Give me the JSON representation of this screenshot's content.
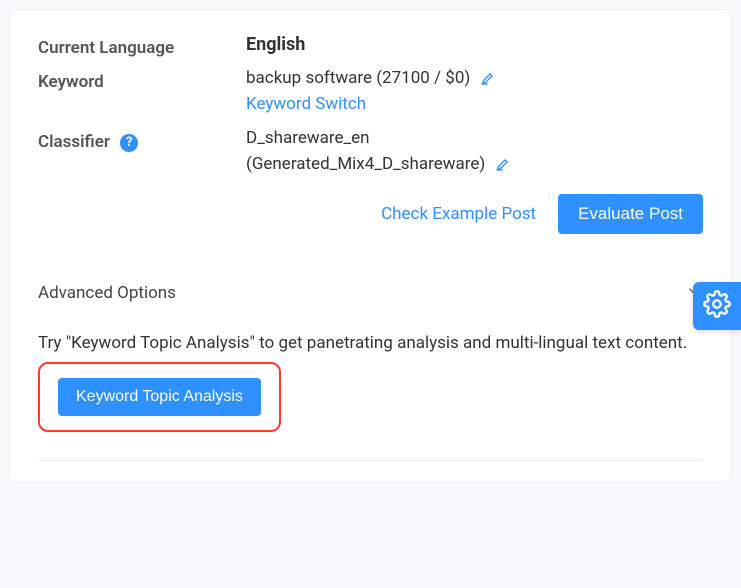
{
  "form": {
    "language_label": "Current Language",
    "language_value": "English",
    "keyword_label": "Keyword",
    "keyword_value": "backup software (27100 / $0)",
    "keyword_switch": "Keyword Switch",
    "classifier_label": "Classifier",
    "classifier_value": "D_shareware_en",
    "classifier_sub": "(Generated_Mix4_D_shareware)"
  },
  "actions": {
    "check_example": "Check Example Post",
    "evaluate": "Evaluate Post"
  },
  "advanced": {
    "title": "Advanced Options",
    "hint": "Try \"Keyword Topic Analysis\" to get panetrating analysis and multi-lingual text content.",
    "cta": "Keyword Topic Analysis"
  }
}
